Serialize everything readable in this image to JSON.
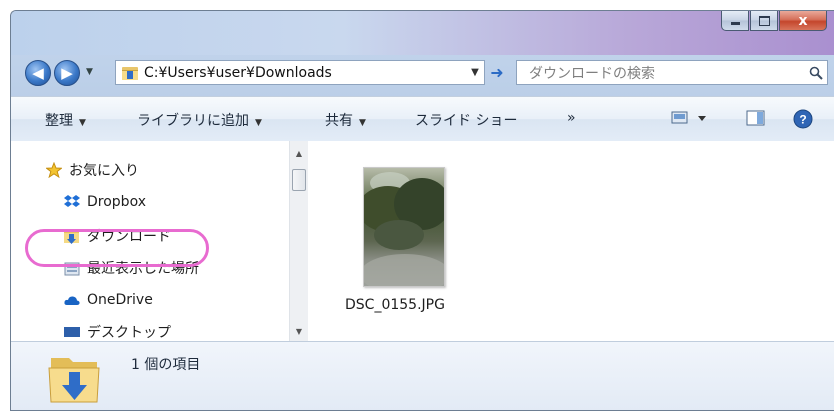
{
  "window": {
    "close_label": "x"
  },
  "address": {
    "path": "C:¥Users¥user¥Downloads"
  },
  "search": {
    "placeholder": "ダウンロードの検索"
  },
  "toolbar": {
    "organize": "整理",
    "add_to_library": "ライブラリに追加",
    "share": "共有",
    "slideshow": "スライド ショー",
    "more": "»"
  },
  "nav": {
    "favorites": "お気に入り",
    "dropbox": "Dropbox",
    "downloads": "ダウンロード",
    "recent": "最近表示した場所",
    "onedrive": "OneDrive",
    "desktop": "デスクトップ"
  },
  "files": [
    {
      "name": "DSC_0155.JPG"
    }
  ],
  "status": {
    "item_count": "1 個の項目"
  },
  "colors": {
    "highlight": "#e86bd0"
  }
}
